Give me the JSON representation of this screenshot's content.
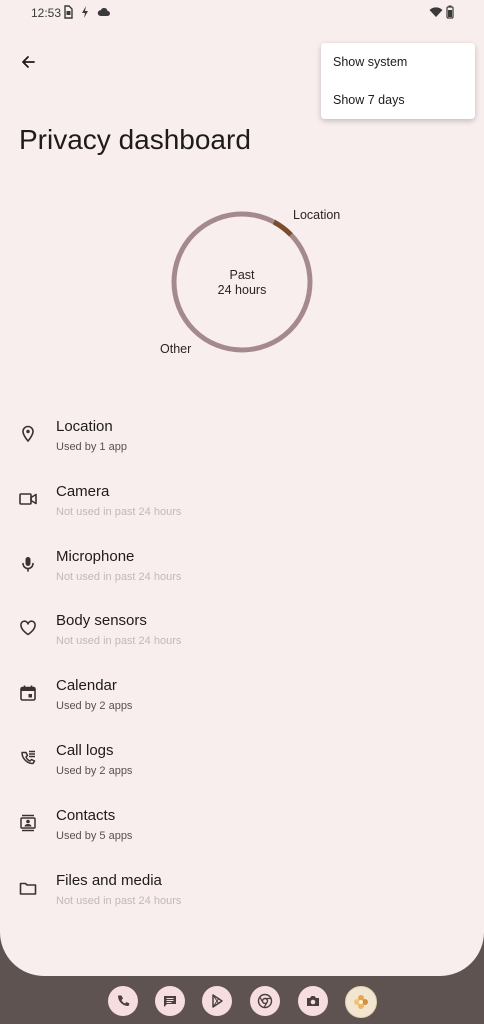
{
  "status_bar": {
    "time": "12:53"
  },
  "header": {
    "title": "Privacy dashboard"
  },
  "overflow_menu": {
    "items": [
      {
        "label": "Show system"
      },
      {
        "label": "Show 7 days"
      }
    ]
  },
  "usage_chart": {
    "center_line1": "Past",
    "center_line2": "24 hours",
    "label_location": "Location",
    "label_other": "Other",
    "colors": {
      "location": "#7a4e2b",
      "other": "#a48a8e"
    }
  },
  "permissions": [
    {
      "title": "Location",
      "subtitle": "Used by 1 app",
      "icon": "location-pin-icon"
    },
    {
      "title": "Camera",
      "subtitle": "Not used in past 24 hours",
      "icon": "camera-icon"
    },
    {
      "title": "Microphone",
      "subtitle": "Not used in past 24 hours",
      "icon": "microphone-icon"
    },
    {
      "title": "Body sensors",
      "subtitle": "Not used in past 24 hours",
      "icon": "heart-icon"
    },
    {
      "title": "Calendar",
      "subtitle": "Used by 2 apps",
      "icon": "calendar-icon"
    },
    {
      "title": "Call logs",
      "subtitle": "Used by 2 apps",
      "icon": "call-log-icon"
    },
    {
      "title": "Contacts",
      "subtitle": "Used by 5 apps",
      "icon": "contacts-icon"
    },
    {
      "title": "Files and media",
      "subtitle": "Not used in past 24 hours",
      "icon": "folder-icon"
    }
  ],
  "dock": {
    "apps": [
      "phone-icon",
      "messages-icon",
      "play-store-icon",
      "chrome-icon",
      "camera-app-icon",
      "photos-icon"
    ]
  }
}
